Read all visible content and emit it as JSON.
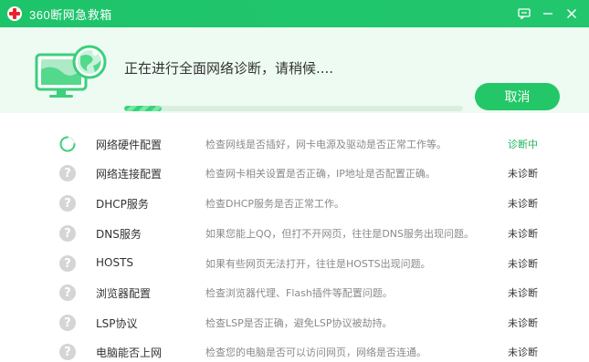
{
  "window": {
    "title": "360断网急救箱",
    "icons": [
      "app-logo-icon",
      "feedback-icon",
      "minimize-icon",
      "close-icon"
    ]
  },
  "header": {
    "status_text": "正在进行全面网络诊断，请稍候....",
    "progress_fraction": 0.11,
    "cancel_label": "取消"
  },
  "colors": {
    "brand_green": "#23c768",
    "active_status": "#23b45c",
    "header_bg": "#eefbf2"
  },
  "items": [
    {
      "name": "网络硬件配置",
      "desc": "检查网线是否插好，网卡电源及驱动是否正常工作等。",
      "status": "诊断中",
      "icon": "loading-spinner-icon"
    },
    {
      "name": "网络连接配置",
      "desc": "检查网卡相关设置是否正确，IP地址是否配置正确。",
      "status": "未诊断",
      "icon": "question-icon"
    },
    {
      "name": "DHCP服务",
      "desc": "检查DHCP服务是否正常工作。",
      "status": "未诊断",
      "icon": "question-icon"
    },
    {
      "name": "DNS服务",
      "desc": "如果您能上QQ，但打不开网页，往往是DNS服务出现问题。",
      "status": "未诊断",
      "icon": "question-icon"
    },
    {
      "name": "HOSTS",
      "desc": "如果有些网页无法打开，往往是HOSTS出现问题。",
      "status": "未诊断",
      "icon": "question-icon"
    },
    {
      "name": "浏览器配置",
      "desc": "检查浏览器代理、Flash插件等配置问题。",
      "status": "未诊断",
      "icon": "question-icon"
    },
    {
      "name": "LSP协议",
      "desc": "检查LSP是否正确，避免LSP协议被劫持。",
      "status": "未诊断",
      "icon": "question-icon"
    },
    {
      "name": "电脑能否上网",
      "desc": "检查您的电脑是否可以访问网页，网络是否连通。",
      "status": "未诊断",
      "icon": "question-icon"
    }
  ]
}
